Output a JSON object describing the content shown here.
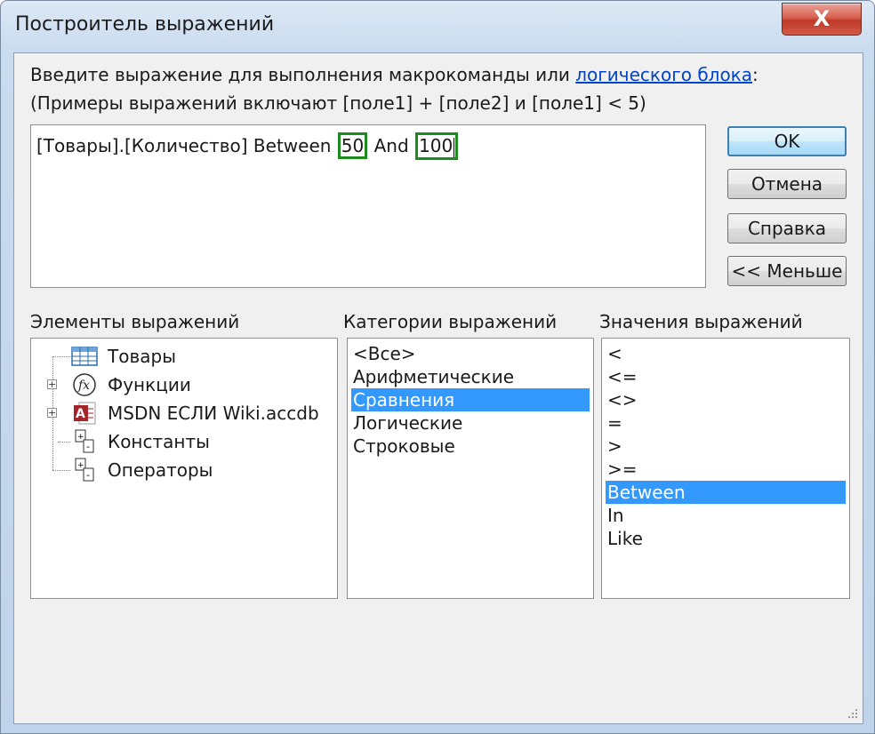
{
  "window": {
    "title": "Построитель выражений",
    "close_label": "X"
  },
  "prompt": {
    "line1_text": "Введите выражение для выполнения макрокоманды или ",
    "line1_link": "логического блока",
    "line1_suffix": ":",
    "line2": "(Примеры выражений включают [поле1] + [поле2] и [поле1] < 5)"
  },
  "expression": {
    "prefix": "[Товары].[Количество] Between ",
    "value1": "50",
    "middle": " And ",
    "value2": "100"
  },
  "buttons": {
    "ok": "OK",
    "cancel": "Отмена",
    "help": "Справка",
    "less": "<< Меньше"
  },
  "elements": {
    "label": "Элементы выражений",
    "items": [
      {
        "label": "Товары",
        "icon": "table-icon",
        "expandable": false
      },
      {
        "label": "Функции",
        "icon": "function-icon",
        "expandable": true
      },
      {
        "label": "MSDN ЕСЛИ Wiki.accdb",
        "icon": "access-database-icon",
        "expandable": true
      },
      {
        "label": "Константы",
        "icon": "constants-icon",
        "expandable": false
      },
      {
        "label": "Операторы",
        "icon": "operators-icon",
        "expandable": false
      }
    ]
  },
  "categories": {
    "label": "Категории выражений",
    "items": [
      "<Все>",
      "Арифметические",
      "Сравнения",
      "Логические",
      "Строковые"
    ],
    "selected": "Сравнения"
  },
  "values": {
    "label": "Значения выражений",
    "items": [
      "<",
      "<=",
      "<>",
      "=",
      ">",
      ">=",
      "Between",
      "In",
      "Like"
    ],
    "selected": "Between"
  },
  "colors": {
    "selection": "#3399ff",
    "highlight_box": "#1d8a1d",
    "link": "#0044cc",
    "close_button": "#c0392b"
  }
}
